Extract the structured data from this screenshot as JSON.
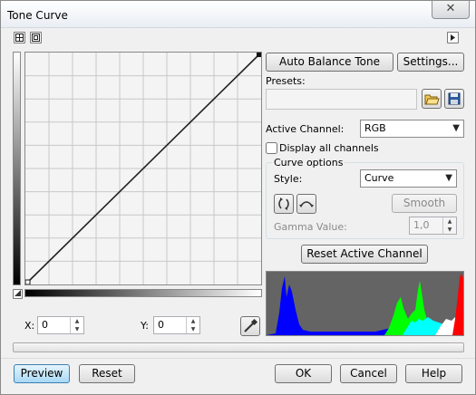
{
  "window": {
    "title": "Tone Curve",
    "close_label": "✕"
  },
  "toolbar": {
    "small_btn_1_icon": "grid-small-icon",
    "small_btn_2_icon": "grid-large-icon",
    "expand_icon": "play-right-icon"
  },
  "buttons": {
    "auto_balance": "Auto Balance Tone",
    "settings": "Settings...",
    "smooth": "Smooth",
    "reset_active_channel": "Reset Active Channel",
    "preview": "Preview",
    "reset": "Reset",
    "ok": "OK",
    "cancel": "Cancel",
    "help": "Help"
  },
  "presets": {
    "label": "Presets:",
    "value": ""
  },
  "active_channel": {
    "label": "Active Channel:",
    "value": "RGB"
  },
  "display_all_channels": {
    "label": "Display all channels",
    "checked": false
  },
  "curve_options": {
    "legend": "Curve options",
    "style_label": "Style:",
    "style_value": "Curve",
    "gamma_label": "Gamma Value:",
    "gamma_value": "1,0"
  },
  "coords": {
    "x_label": "X:",
    "x_value": "0",
    "y_label": "Y:",
    "y_value": "0"
  },
  "colors": {
    "accent": "#a9d9f5",
    "histogram_bg": "#646464",
    "hist_blue": "#0000ff",
    "hist_green": "#00ff00",
    "hist_cyan": "#00ffff",
    "hist_red": "#ff0000"
  }
}
